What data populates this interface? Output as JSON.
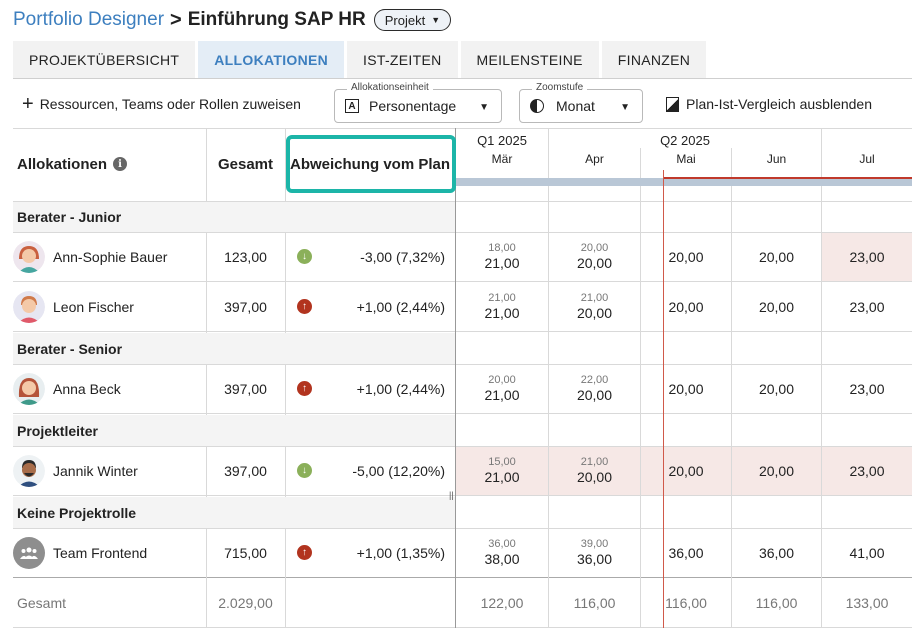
{
  "breadcrumb": {
    "app": "Portfolio Designer",
    "separator": ">",
    "title": "Einführung SAP HR",
    "badge": "Projekt"
  },
  "tabs": [
    {
      "label": "PROJEKTÜBERSICHT",
      "active": false
    },
    {
      "label": "ALLOKATIONEN",
      "active": true
    },
    {
      "label": "IST-ZEITEN",
      "active": false
    },
    {
      "label": "MEILENSTEINE",
      "active": false
    },
    {
      "label": "FINANZEN",
      "active": false
    }
  ],
  "toolbar": {
    "assign_label": "Ressourcen, Teams oder Rollen zuweisen",
    "unit_legend": "Allokationseinheit",
    "unit_value": "Personentage",
    "zoom_legend": "Zoomstufe",
    "zoom_value": "Monat",
    "compare_label": "Plan-Ist-Vergleich ausblenden"
  },
  "table": {
    "col_allocations": "Allokationen",
    "col_total": "Gesamt",
    "col_deviation": "Abweichung vom Plan",
    "quarters": [
      "Q1 2025",
      "Q2 2025"
    ],
    "months": [
      "Mär",
      "Apr",
      "Mai",
      "Jun",
      "Jul"
    ],
    "groups": [
      {
        "label": "Berater - Junior"
      },
      {
        "label": "Berater - Senior"
      },
      {
        "label": "Projektleiter"
      },
      {
        "label": "Keine Projektrolle"
      }
    ],
    "rows": [
      {
        "name": "Ann-Sophie Bauer",
        "total": "123,00",
        "trend": "down",
        "deviation": "-3,00 (7,32%)",
        "mar_plan": "18,00",
        "mar": "21,00",
        "apr_plan": "20,00",
        "apr": "20,00",
        "mai": "20,00",
        "jun": "20,00",
        "jul": "23,00"
      },
      {
        "name": "Leon Fischer",
        "total": "397,00",
        "trend": "up",
        "deviation": "+1,00 (2,44%)",
        "mar_plan": "21,00",
        "mar": "21,00",
        "apr_plan": "21,00",
        "apr": "20,00",
        "mai": "20,00",
        "jun": "20,00",
        "jul": "23,00"
      },
      {
        "name": "Anna Beck",
        "total": "397,00",
        "trend": "up",
        "deviation": "+1,00 (2,44%)",
        "mar_plan": "20,00",
        "mar": "21,00",
        "apr_plan": "22,00",
        "apr": "20,00",
        "mai": "20,00",
        "jun": "20,00",
        "jul": "23,00"
      },
      {
        "name": "Jannik Winter",
        "total": "397,00",
        "trend": "down",
        "deviation": "-5,00 (12,20%)",
        "mar_plan": "15,00",
        "mar": "21,00",
        "apr_plan": "21,00",
        "apr": "20,00",
        "mai": "20,00",
        "jun": "20,00",
        "jul": "23,00"
      },
      {
        "name": "Team Frontend",
        "total": "715,00",
        "trend": "up",
        "deviation": "+1,00 (1,35%)",
        "mar_plan": "36,00",
        "mar": "38,00",
        "apr_plan": "39,00",
        "apr": "36,00",
        "mai": "36,00",
        "jun": "36,00",
        "jul": "41,00"
      }
    ],
    "totals": {
      "label": "Gesamt",
      "total": "2.029,00",
      "mar": "122,00",
      "apr": "116,00",
      "mai": "116,00",
      "jun": "116,00",
      "jul": "133,00"
    }
  },
  "icons": {
    "info": "info-icon",
    "trend_down": "arrow-down-icon",
    "trend_up": "arrow-up-icon",
    "team": "team-icon"
  },
  "colors": {
    "accent": "#3d7fbf",
    "highlight": "#1cb5a8",
    "down": "#8bb05a",
    "up": "#b2341f",
    "today": "#d0594a",
    "overplan": "#f6e8e6"
  }
}
